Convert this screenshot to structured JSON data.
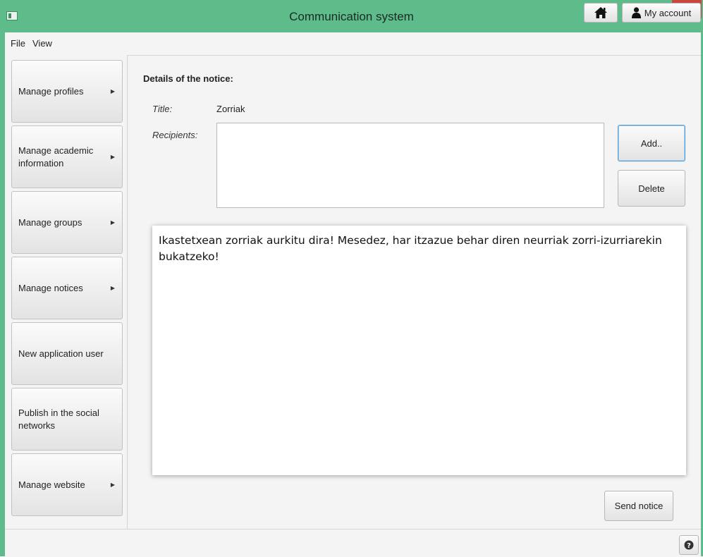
{
  "window": {
    "title": "Communication system"
  },
  "menu": {
    "file": "File",
    "view": "View"
  },
  "toolbar": {
    "home_icon": "home-icon",
    "account_label": "My account",
    "account_icon": "user-icon"
  },
  "sidebar": {
    "items": [
      {
        "label": "Manage profiles",
        "has_arrow": true
      },
      {
        "label": "Manage academic information",
        "has_arrow": true
      },
      {
        "label": "Manage groups",
        "has_arrow": true
      },
      {
        "label": "Manage notices",
        "has_arrow": true
      },
      {
        "label": "New application user",
        "has_arrow": false
      },
      {
        "label": "Publish in the social networks",
        "has_arrow": false
      },
      {
        "label": "Manage website",
        "has_arrow": true
      }
    ]
  },
  "notice": {
    "section_title": "Details of the notice:",
    "title_label": "Title:",
    "title_value": "Zorriak",
    "recipients_label": "Recipients:",
    "add_label": "Add..",
    "delete_label": "Delete",
    "message": "Ikastetxean zorriak aurkitu dira! Mesedez, har itzazue behar diren neurriak zorri-izurriarekin bukatzeko!",
    "send_label": "Send notice"
  },
  "colors": {
    "titlebar": "#5ebc8b",
    "close_button": "#c9463d",
    "focus_border": "#4f9bd3"
  }
}
